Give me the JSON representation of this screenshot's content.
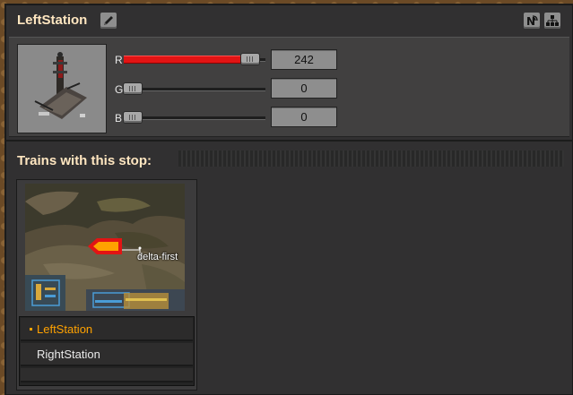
{
  "window": {
    "title": "LeftStation"
  },
  "color": {
    "r": {
      "label": "R",
      "value": "242",
      "fraction": 0.949
    },
    "g": {
      "label": "G",
      "value": "0",
      "fraction": 0.0
    },
    "b": {
      "label": "B",
      "value": "0",
      "fraction": 0.0
    },
    "fill_color": "#e21414"
  },
  "trains_section": {
    "heading": "Trains with this stop:",
    "train": {
      "name": "delta-first",
      "schedule": [
        {
          "name": "LeftStation",
          "current": true
        },
        {
          "name": "RightStation",
          "current": false
        }
      ]
    }
  },
  "icons": {
    "edit": "pencil-icon",
    "network": "circuit-network-icon",
    "logistics": "logistics-network-icon"
  }
}
